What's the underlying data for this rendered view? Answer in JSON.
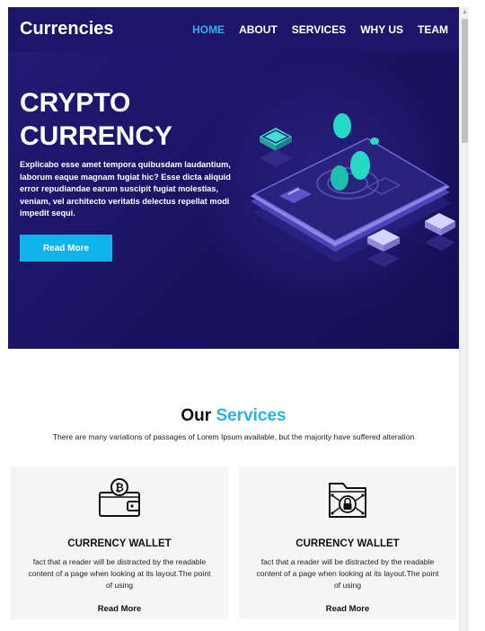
{
  "brand": "Currencies",
  "nav": [
    "HOME",
    "ABOUT",
    "SERVICES",
    "WHY US",
    "TEAM"
  ],
  "active_nav": "HOME",
  "hero": {
    "title_line1": "CRYPTO",
    "title_line2": "CURRENCY",
    "text": "Explicabo esse amet tempora quibusdam laudantium, laborum eaque magnam fugiat hic? Esse dicta aliquid error repudiandae earum suscipit fugiat molestias, veniam, vel architecto veritatis delectus repellat modi impedit sequi.",
    "button": "Read More"
  },
  "services": {
    "title_part1": "Our",
    "title_part2": "Services",
    "subtitle": "There are many variations of passages of Lorem Ipsum available, but the majority have suffered alteration",
    "cards": [
      {
        "icon": "bitcoin-wallet-icon",
        "title": "CURRENCY WALLET",
        "text": "fact that a reader will be distracted by the readable content of a page when looking at its layout.The point of using",
        "link": "Read More"
      },
      {
        "icon": "secure-folder-icon",
        "title": "CURRENCY WALLET",
        "text": "fact that a reader will be distracted by the readable content of a page when looking at its layout.The point of using",
        "link": "Read More"
      }
    ]
  },
  "colors": {
    "hero_bg": "#1d1569",
    "accent": "#27b3ef",
    "button": "#10b3ec",
    "card_bg": "#f5f5f5"
  }
}
